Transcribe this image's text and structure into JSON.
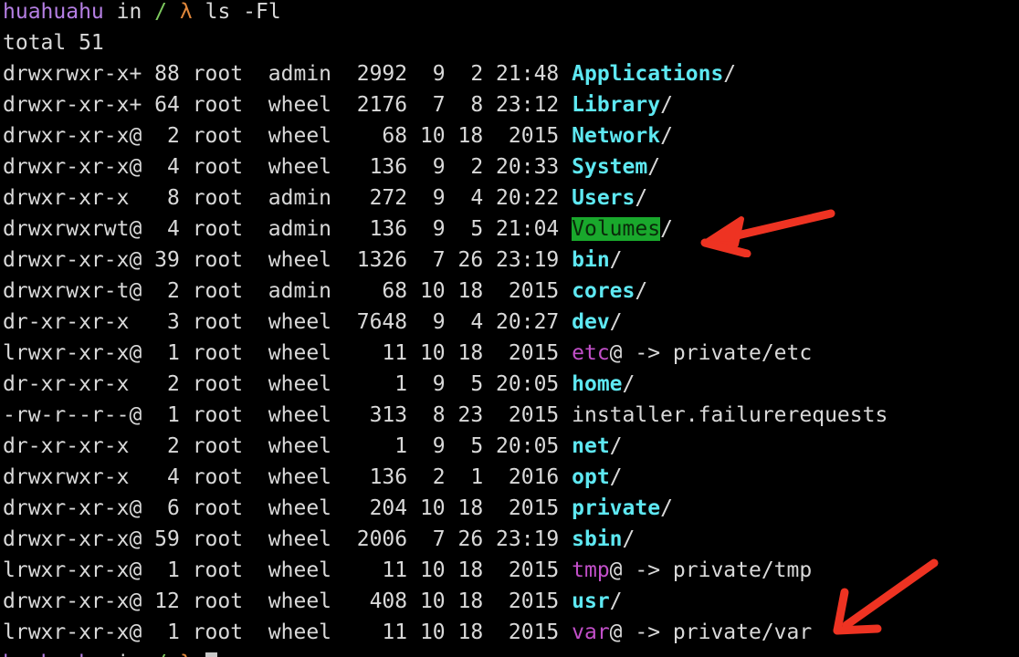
{
  "prompt": {
    "user": "huahuahu",
    "in_word": " in ",
    "path": "/",
    "lambda": "λ",
    "command": " ls -Fl"
  },
  "total_line": "total 51",
  "rows": [
    {
      "meta": "drwxrwxr-x+ 88 root  admin  2992  9  2 21:48 ",
      "name": "Applications",
      "suffix": "/",
      "type": "dir"
    },
    {
      "meta": "drwxr-xr-x+ 64 root  wheel  2176  7  8 23:12 ",
      "name": "Library",
      "suffix": "/",
      "type": "dir"
    },
    {
      "meta": "drwxr-xr-x@  2 root  wheel    68 10 18  2015 ",
      "name": "Network",
      "suffix": "/",
      "type": "dir"
    },
    {
      "meta": "drwxr-xr-x@  4 root  wheel   136  9  2 20:33 ",
      "name": "System",
      "suffix": "/",
      "type": "dir"
    },
    {
      "meta": "drwxr-xr-x   8 root  admin   272  9  4 20:22 ",
      "name": "Users",
      "suffix": "/",
      "type": "dir"
    },
    {
      "meta": "drwxrwxrwt@  4 root  admin   136  9  5 21:04 ",
      "name": "Volumes",
      "suffix": "/",
      "type": "dir-hl"
    },
    {
      "meta": "drwxr-xr-x@ 39 root  wheel  1326  7 26 23:19 ",
      "name": "bin",
      "suffix": "/",
      "type": "dir"
    },
    {
      "meta": "drwxrwxr-t@  2 root  admin    68 10 18  2015 ",
      "name": "cores",
      "suffix": "/",
      "type": "dir"
    },
    {
      "meta": "dr-xr-xr-x   3 root  wheel  7648  9  4 20:27 ",
      "name": "dev",
      "suffix": "/",
      "type": "dir"
    },
    {
      "meta": "lrwxr-xr-x@  1 root  wheel    11 10 18  2015 ",
      "name": "etc",
      "suffix": "@ -> private/etc",
      "type": "link"
    },
    {
      "meta": "dr-xr-xr-x   2 root  wheel     1  9  5 20:05 ",
      "name": "home",
      "suffix": "/",
      "type": "dir"
    },
    {
      "meta": "-rw-r--r--@  1 root  wheel   313  8 23  2015 ",
      "name": "installer.failurerequests",
      "suffix": "",
      "type": "file"
    },
    {
      "meta": "dr-xr-xr-x   2 root  wheel     1  9  5 20:05 ",
      "name": "net",
      "suffix": "/",
      "type": "dir"
    },
    {
      "meta": "drwxrwxr-x   4 root  wheel   136  2  1  2016 ",
      "name": "opt",
      "suffix": "/",
      "type": "dir"
    },
    {
      "meta": "drwxr-xr-x@  6 root  wheel   204 10 18  2015 ",
      "name": "private",
      "suffix": "/",
      "type": "dir"
    },
    {
      "meta": "drwxr-xr-x@ 59 root  wheel  2006  7 26 23:19 ",
      "name": "sbin",
      "suffix": "/",
      "type": "dir"
    },
    {
      "meta": "lrwxr-xr-x@  1 root  wheel    11 10 18  2015 ",
      "name": "tmp",
      "suffix": "@ -> private/tmp",
      "type": "link"
    },
    {
      "meta": "drwxr-xr-x@ 12 root  wheel   408 10 18  2015 ",
      "name": "usr",
      "suffix": "/",
      "type": "dir"
    },
    {
      "meta": "lrwxr-xr-x@  1 root  wheel    11 10 18  2015 ",
      "name": "var",
      "suffix": "@ -> private/var",
      "type": "link"
    }
  ],
  "annotation_icons": [
    "red-arrow-icon",
    "red-arrow-icon"
  ],
  "colors": {
    "background": "#000000",
    "text": "#d9d9d9",
    "user": "#b57fe3",
    "path": "#7dc95e",
    "lambda": "#e0873b",
    "directory": "#5ee8f2",
    "symlink": "#c24fc9",
    "highlight": "#19a82c",
    "arrow": "#ee3322"
  }
}
